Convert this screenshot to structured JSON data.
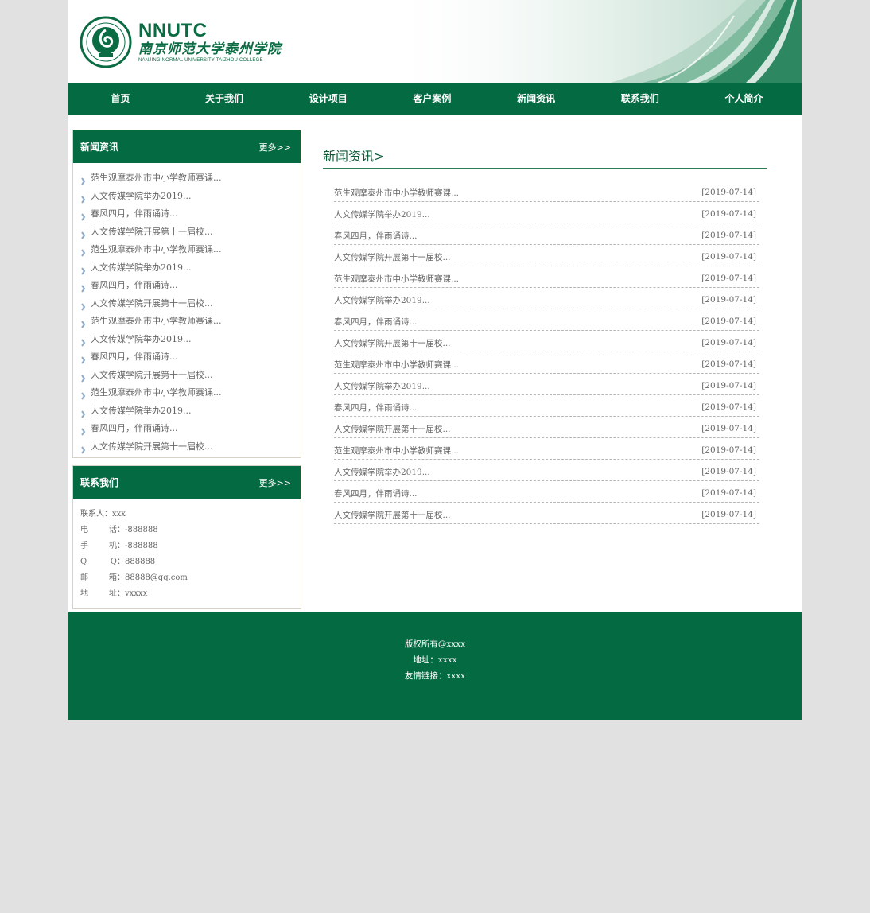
{
  "header": {
    "logo_abbr": "NNUTC",
    "logo_cn": "南京师范大学泰州学院",
    "logo_en": "NANJING NORMAL UNIVERSITY TAIZHOU COLLEGE"
  },
  "nav": [
    {
      "label": "首页"
    },
    {
      "label": "关于我们"
    },
    {
      "label": "设计项目"
    },
    {
      "label": "客户案例"
    },
    {
      "label": "新闻资讯"
    },
    {
      "label": "联系我们"
    },
    {
      "label": "个人简介"
    }
  ],
  "sidebar": {
    "news_box": {
      "title": "新闻资讯",
      "more": "更多>>",
      "items": [
        "范生观摩泰州市中小学教师赛课...",
        "人文传媒学院举办2019...",
        "春风四月，伴雨诵诗...",
        "人文传媒学院开展第十一届校...",
        "范生观摩泰州市中小学教师赛课...",
        "人文传媒学院举办2019...",
        "春风四月，伴雨诵诗...",
        "人文传媒学院开展第十一届校...",
        "范生观摩泰州市中小学教师赛课...",
        "人文传媒学院举办2019...",
        "春风四月，伴雨诵诗...",
        "人文传媒学院开展第十一届校...",
        "范生观摩泰州市中小学教师赛课...",
        "人文传媒学院举办2019...",
        "春风四月，伴雨诵诗...",
        "人文传媒学院开展第十一届校..."
      ]
    },
    "contact_box": {
      "title": "联系我们",
      "more": "更多>>",
      "rows": [
        {
          "label_chars": [
            "联",
            "系",
            "人"
          ],
          "value": "：xxx"
        },
        {
          "label_chars": [
            "电",
            "话"
          ],
          "value": "：-888888"
        },
        {
          "label_chars": [
            "手",
            "机"
          ],
          "value": "：-888888"
        },
        {
          "label_chars": [
            "Q",
            "Q"
          ],
          "value": "：888888"
        },
        {
          "label_chars": [
            "邮",
            "箱"
          ],
          "value": "：88888@qq.com"
        },
        {
          "label_chars": [
            "地",
            "址"
          ],
          "value": "：vxxxx"
        }
      ]
    }
  },
  "content": {
    "title": "新闻资讯>",
    "items": [
      {
        "title": "范生观摩泰州市中小学教师赛课...",
        "date": "[2019-07-14]"
      },
      {
        "title": "人文传媒学院举办2019...",
        "date": "[2019-07-14]"
      },
      {
        "title": "春风四月，伴雨诵诗...",
        "date": "[2019-07-14]"
      },
      {
        "title": "人文传媒学院开展第十一届校...",
        "date": "[2019-07-14]"
      },
      {
        "title": "范生观摩泰州市中小学教师赛课...",
        "date": "[2019-07-14]"
      },
      {
        "title": "人文传媒学院举办2019...",
        "date": "[2019-07-14]"
      },
      {
        "title": "春风四月，伴雨诵诗...",
        "date": "[2019-07-14]"
      },
      {
        "title": "人文传媒学院开展第十一届校...",
        "date": "[2019-07-14]"
      },
      {
        "title": "范生观摩泰州市中小学教师赛课...",
        "date": "[2019-07-14]"
      },
      {
        "title": "人文传媒学院举办2019...",
        "date": "[2019-07-14]"
      },
      {
        "title": "春风四月，伴雨诵诗...",
        "date": "[2019-07-14]"
      },
      {
        "title": "人文传媒学院开展第十一届校...",
        "date": "[2019-07-14]"
      },
      {
        "title": "范生观摩泰州市中小学教师赛课...",
        "date": "[2019-07-14]"
      },
      {
        "title": "人文传媒学院举办2019...",
        "date": "[2019-07-14]"
      },
      {
        "title": "春风四月，伴雨诵诗...",
        "date": "[2019-07-14]"
      },
      {
        "title": "人文传媒学院开展第十一届校...",
        "date": "[2019-07-14]"
      }
    ]
  },
  "footer": {
    "copyright": "版权所有@xxxx",
    "address": "地址：xxxx",
    "links": "友情链接：xxxx"
  },
  "colors": {
    "brand_green": "#036a42",
    "page_bg": "#e1e1e1"
  }
}
